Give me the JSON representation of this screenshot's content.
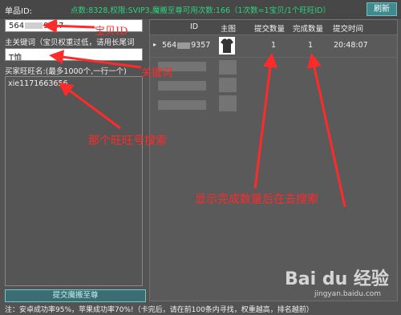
{
  "top_bar": {
    "product_id_label": "单品ID:",
    "points_info": "点数:8328,权限:SVIP3,魔搬至尊可用次数:166（1次数=1宝贝/1个旺旺ID）",
    "refresh_label": "刷新"
  },
  "form": {
    "product_id_prefix": "564",
    "product_id_suffix": "9357",
    "keyword_label": "主关键词（宝贝权重过低，请用长尾词",
    "keyword_value": "T恤",
    "buyer_label": "买家旺旺名:(最多1000个,一行一个)",
    "buyer_value": "xie1171663656",
    "submit_label": "提交魔搬至尊"
  },
  "footer_note": "注：安卓成功率95%，苹果成功率70%!（卡完后，请在前100条内寻找，权重越高，排名越前）",
  "table": {
    "headers": [
      "ID",
      "主图",
      "提交数量",
      "完成数量",
      "提交时间"
    ],
    "rows": [
      {
        "id_prefix": "564",
        "id_suffix": "9357",
        "submitted": "1",
        "completed": "1",
        "time": "20:48:07"
      }
    ]
  },
  "annotations": {
    "product_id": "宝贝ID",
    "keyword": "关键词",
    "buyer": "那个旺旺号搜索",
    "completion": "显示完成数量后在去搜索"
  },
  "watermark": {
    "text": "Bai du 经验",
    "sub": "jingyan.baidu.com"
  },
  "colors": {
    "background": "#535353",
    "accent": "#3e8a8e",
    "info_green": "#2fd27d",
    "annotation_red": "#ff2a2a"
  }
}
